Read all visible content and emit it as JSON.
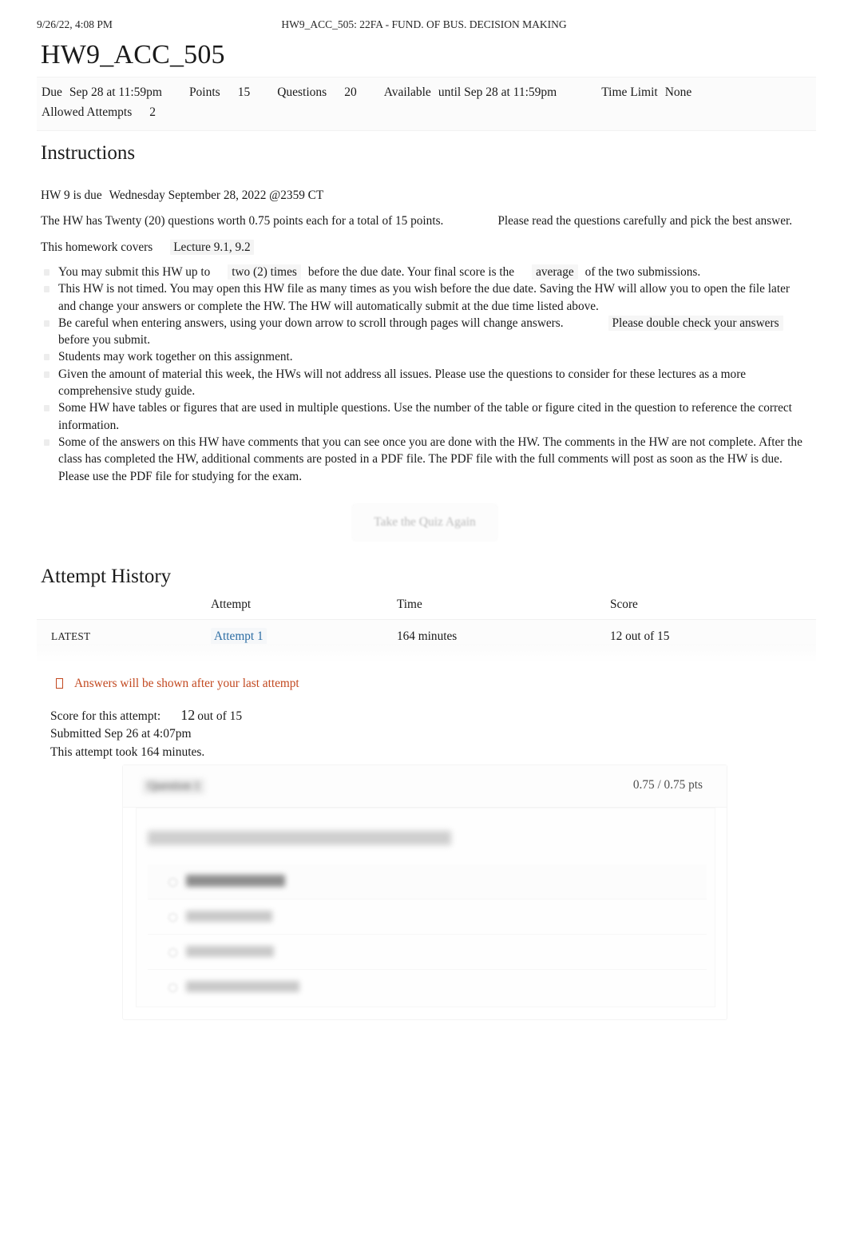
{
  "print_header": {
    "timestamp": "9/26/22, 4:08 PM",
    "document_title": "HW9_ACC_505: 22FA - FUND. OF BUS. DECISION MAKING"
  },
  "quiz": {
    "title": "HW9_ACC_505",
    "meta": {
      "due_label": "Due",
      "due_value": "Sep 28 at 11:59pm",
      "points_label": "Points",
      "points_value": "15",
      "questions_label": "Questions",
      "questions_value": "20",
      "available_label": "Available",
      "available_value": "until Sep 28 at 11:59pm",
      "time_limit_label": "Time Limit",
      "time_limit_value": "None",
      "allowed_attempts_label": "Allowed Attempts",
      "allowed_attempts_value": "2"
    }
  },
  "instructions": {
    "heading": "Instructions",
    "due_prefix": "HW 9 is due",
    "due_detail": "Wednesday September 28, 2022 @2359 CT",
    "points_line": "The HW has Twenty (20) questions worth 0.75 points each for a total of 15 points.",
    "points_line_extra": "Please read the questions carefully and pick the best answer.",
    "covers_prefix": "This homework covers",
    "covers_value": "Lecture 9.1, 9.2",
    "bullets": [
      {
        "a": "You may submit this HW up to",
        "b": "two (2) times",
        "c": "before the due date. Your final score is the",
        "d": "average",
        "e": "of the two submissions."
      },
      {
        "a": "This HW is not timed. You may open this HW file as many times as you wish before the due date. Saving the HW will allow you to open the file later and change your answers or complete the HW. The HW will automatically submit at the due time listed above."
      },
      {
        "a": "Be careful when entering answers, using your down arrow to scroll through pages will change answers.",
        "b": "Please double check your answers",
        "c": "before you submit."
      },
      {
        "a": "Students may work together on this assignment."
      },
      {
        "a": "Given the amount of material this week, the HWs will not address all issues. Please use the questions to consider for these lectures as a more comprehensive study guide."
      },
      {
        "a": "Some HW have tables or figures that are used in multiple questions. Use the number of the table or figure cited in the question to reference the correct information."
      },
      {
        "a": "Some of the answers on this HW have comments that you can see once you are done with the HW. The comments in the HW are not complete. After the class has completed the HW, additional comments are posted in a PDF file. The PDF file with the full comments will post as soon as the HW is due. Please use the PDF file for studying for the exam."
      }
    ]
  },
  "actions": {
    "take_quiz_again": "Take the Quiz Again"
  },
  "attempt_history": {
    "heading": "Attempt History",
    "columns": [
      "",
      "Attempt",
      "Time",
      "Score"
    ],
    "rows": [
      {
        "kept": "LATEST",
        "attempt": "Attempt 1",
        "time": "164 minutes",
        "score": "12 out of 15"
      }
    ]
  },
  "answers_notice": {
    "text": "Answers will be shown after your last attempt",
    "color": "#c2481f"
  },
  "attempt_summary": {
    "score_label": "Score for this attempt:",
    "score_value": "12",
    "score_suffix": "out of 15",
    "submitted": "Submitted Sep 26 at 4:07pm",
    "duration": "This attempt took 164 minutes."
  },
  "question_card": {
    "title": "Question 1",
    "points": "0.75 / 0.75 pts",
    "answer_count": 4,
    "selected_index": 0,
    "blurred": true
  },
  "colors": {
    "link": "#2b6ca3",
    "notice": "#c2481f",
    "text": "#1a1a1a",
    "meta_bg": "#fbfbfb"
  }
}
